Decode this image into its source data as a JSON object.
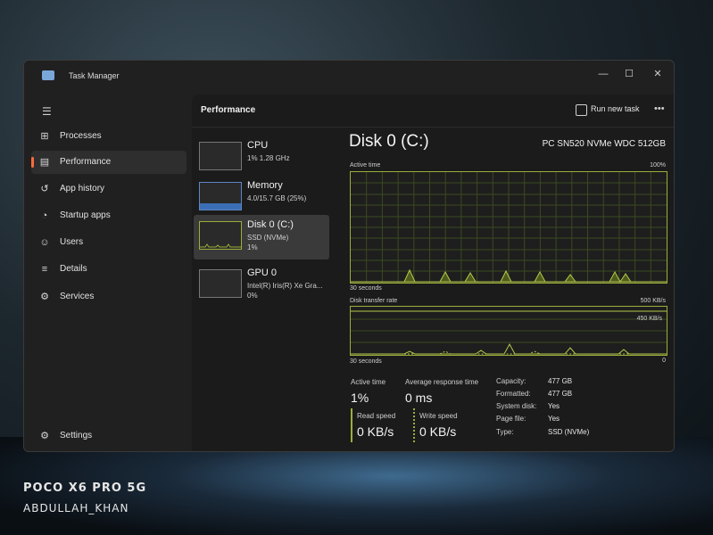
{
  "window": {
    "title": "Task Manager",
    "controls": [
      "—",
      "☐",
      "✕"
    ]
  },
  "sidebar": {
    "items": [
      {
        "label": "Processes",
        "icon": "processes-icon"
      },
      {
        "label": "Performance",
        "icon": "performance-icon",
        "active": true
      },
      {
        "label": "App history",
        "icon": "app-history-icon"
      },
      {
        "label": "Startup apps",
        "icon": "startup-apps-icon"
      },
      {
        "label": "Users",
        "icon": "users-icon"
      },
      {
        "label": "Details",
        "icon": "details-icon"
      },
      {
        "label": "Services",
        "icon": "services-icon"
      }
    ],
    "settings_label": "Settings"
  },
  "header": {
    "title": "Performance",
    "run_new_task": "Run new task",
    "more": "•••"
  },
  "perf_list": [
    {
      "name": "CPU",
      "sub1": "1% 1.28 GHz",
      "sub2": ""
    },
    {
      "name": "Memory",
      "sub1": "4.0/15.7 GB (25%)",
      "sub2": "",
      "memory_usage_fraction": 0.25
    },
    {
      "name": "Disk 0 (C:)",
      "sub1": "SSD (NVMe)",
      "sub2": "1%"
    },
    {
      "name": "GPU 0",
      "sub1": "Intel(R) Iris(R) Xe Gra...",
      "sub2": "0%"
    }
  ],
  "detail": {
    "title": "Disk 0 (C:)",
    "model": "PC SN520 NVMe WDC 512GB",
    "active_time_graph": {
      "label": "Active time",
      "max": "100%",
      "xlabel": "30 seconds"
    },
    "transfer_graph": {
      "label": "Disk transfer rate",
      "max": "500 KB/s",
      "ref": "450 KB/s",
      "min": "0",
      "xlabel": "30 seconds"
    },
    "stats": {
      "active_time_label": "Active time",
      "active_time": "1%",
      "avg_response_label": "Average response time",
      "avg_response": "0 ms",
      "read_label": "Read speed",
      "read": "0 KB/s",
      "write_label": "Write speed",
      "write": "0 KB/s"
    },
    "props": [
      {
        "key": "Capacity:",
        "val": "477 GB"
      },
      {
        "key": "Formatted:",
        "val": "477 GB"
      },
      {
        "key": "System disk:",
        "val": "Yes"
      },
      {
        "key": "Page file:",
        "val": "Yes"
      },
      {
        "key": "Type:",
        "val": "SSD (NVMe)"
      }
    ]
  },
  "colors": {
    "disk_accent": "#9aae3b",
    "memory_accent": "#3a6fb5",
    "active_marker": "#ff6a3d"
  },
  "watermark": {
    "line1": "POCO X6 PRO 5G",
    "line2": "ABDULLAH_KHAN"
  }
}
